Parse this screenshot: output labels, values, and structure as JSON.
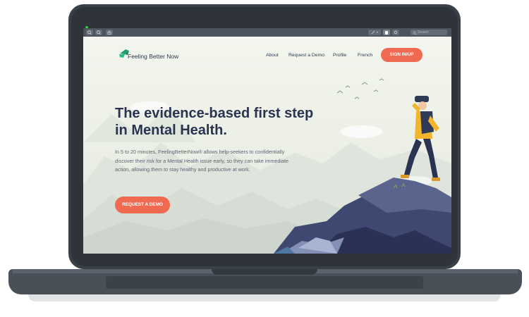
{
  "browser": {
    "toolbar_icons": [
      "zoom-out-icon",
      "zoom-in-icon",
      "share-icon"
    ],
    "right_icons": [
      "pen-icon",
      "hand-icon",
      "gear-icon"
    ],
    "search_placeholder": "Search"
  },
  "site": {
    "logo_text": "Feeling Better Now",
    "nav": {
      "items": [
        {
          "label": "About"
        },
        {
          "label": "Request a Demo"
        },
        {
          "label": "Profile"
        },
        {
          "label": "French"
        }
      ],
      "cta_label": "SIGN IN/UP"
    },
    "hero": {
      "title": "The evidence-based first step in Mental Health.",
      "body": "In 5 to 20 minutes, FeelingBetterNow® allows help-seekers to confidentially discover their risk for a Mental Health issue early, so they can take immediate action, allowing them to stay healthy and productive at work.",
      "cta_label": "REQUEST A DEMO"
    }
  },
  "colors": {
    "accent": "#ef6a50",
    "heading": "#2a3350",
    "brand_green": "#1f9e73",
    "laptop": "#3a4048"
  }
}
